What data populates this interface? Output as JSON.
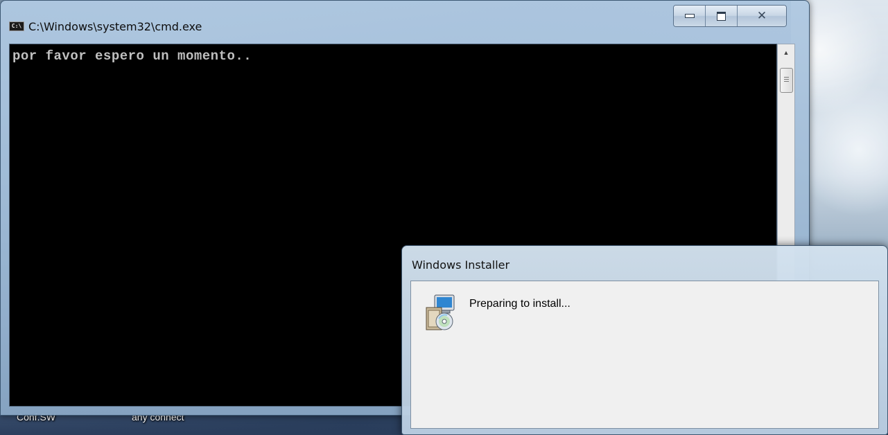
{
  "desktop": {
    "icon_labels": [
      "Conf.SW",
      "any connect"
    ]
  },
  "cmd_window": {
    "title": "C:\\Windows\\system32\\cmd.exe",
    "icon_text": "C:\\",
    "console_output": "por favor espero un momento..",
    "caption_buttons": [
      "minimize-icon",
      "maximize-icon",
      "close-icon"
    ],
    "close_glyph": "✕"
  },
  "installer_dialog": {
    "title": "Windows Installer",
    "message": "Preparing to install..."
  }
}
